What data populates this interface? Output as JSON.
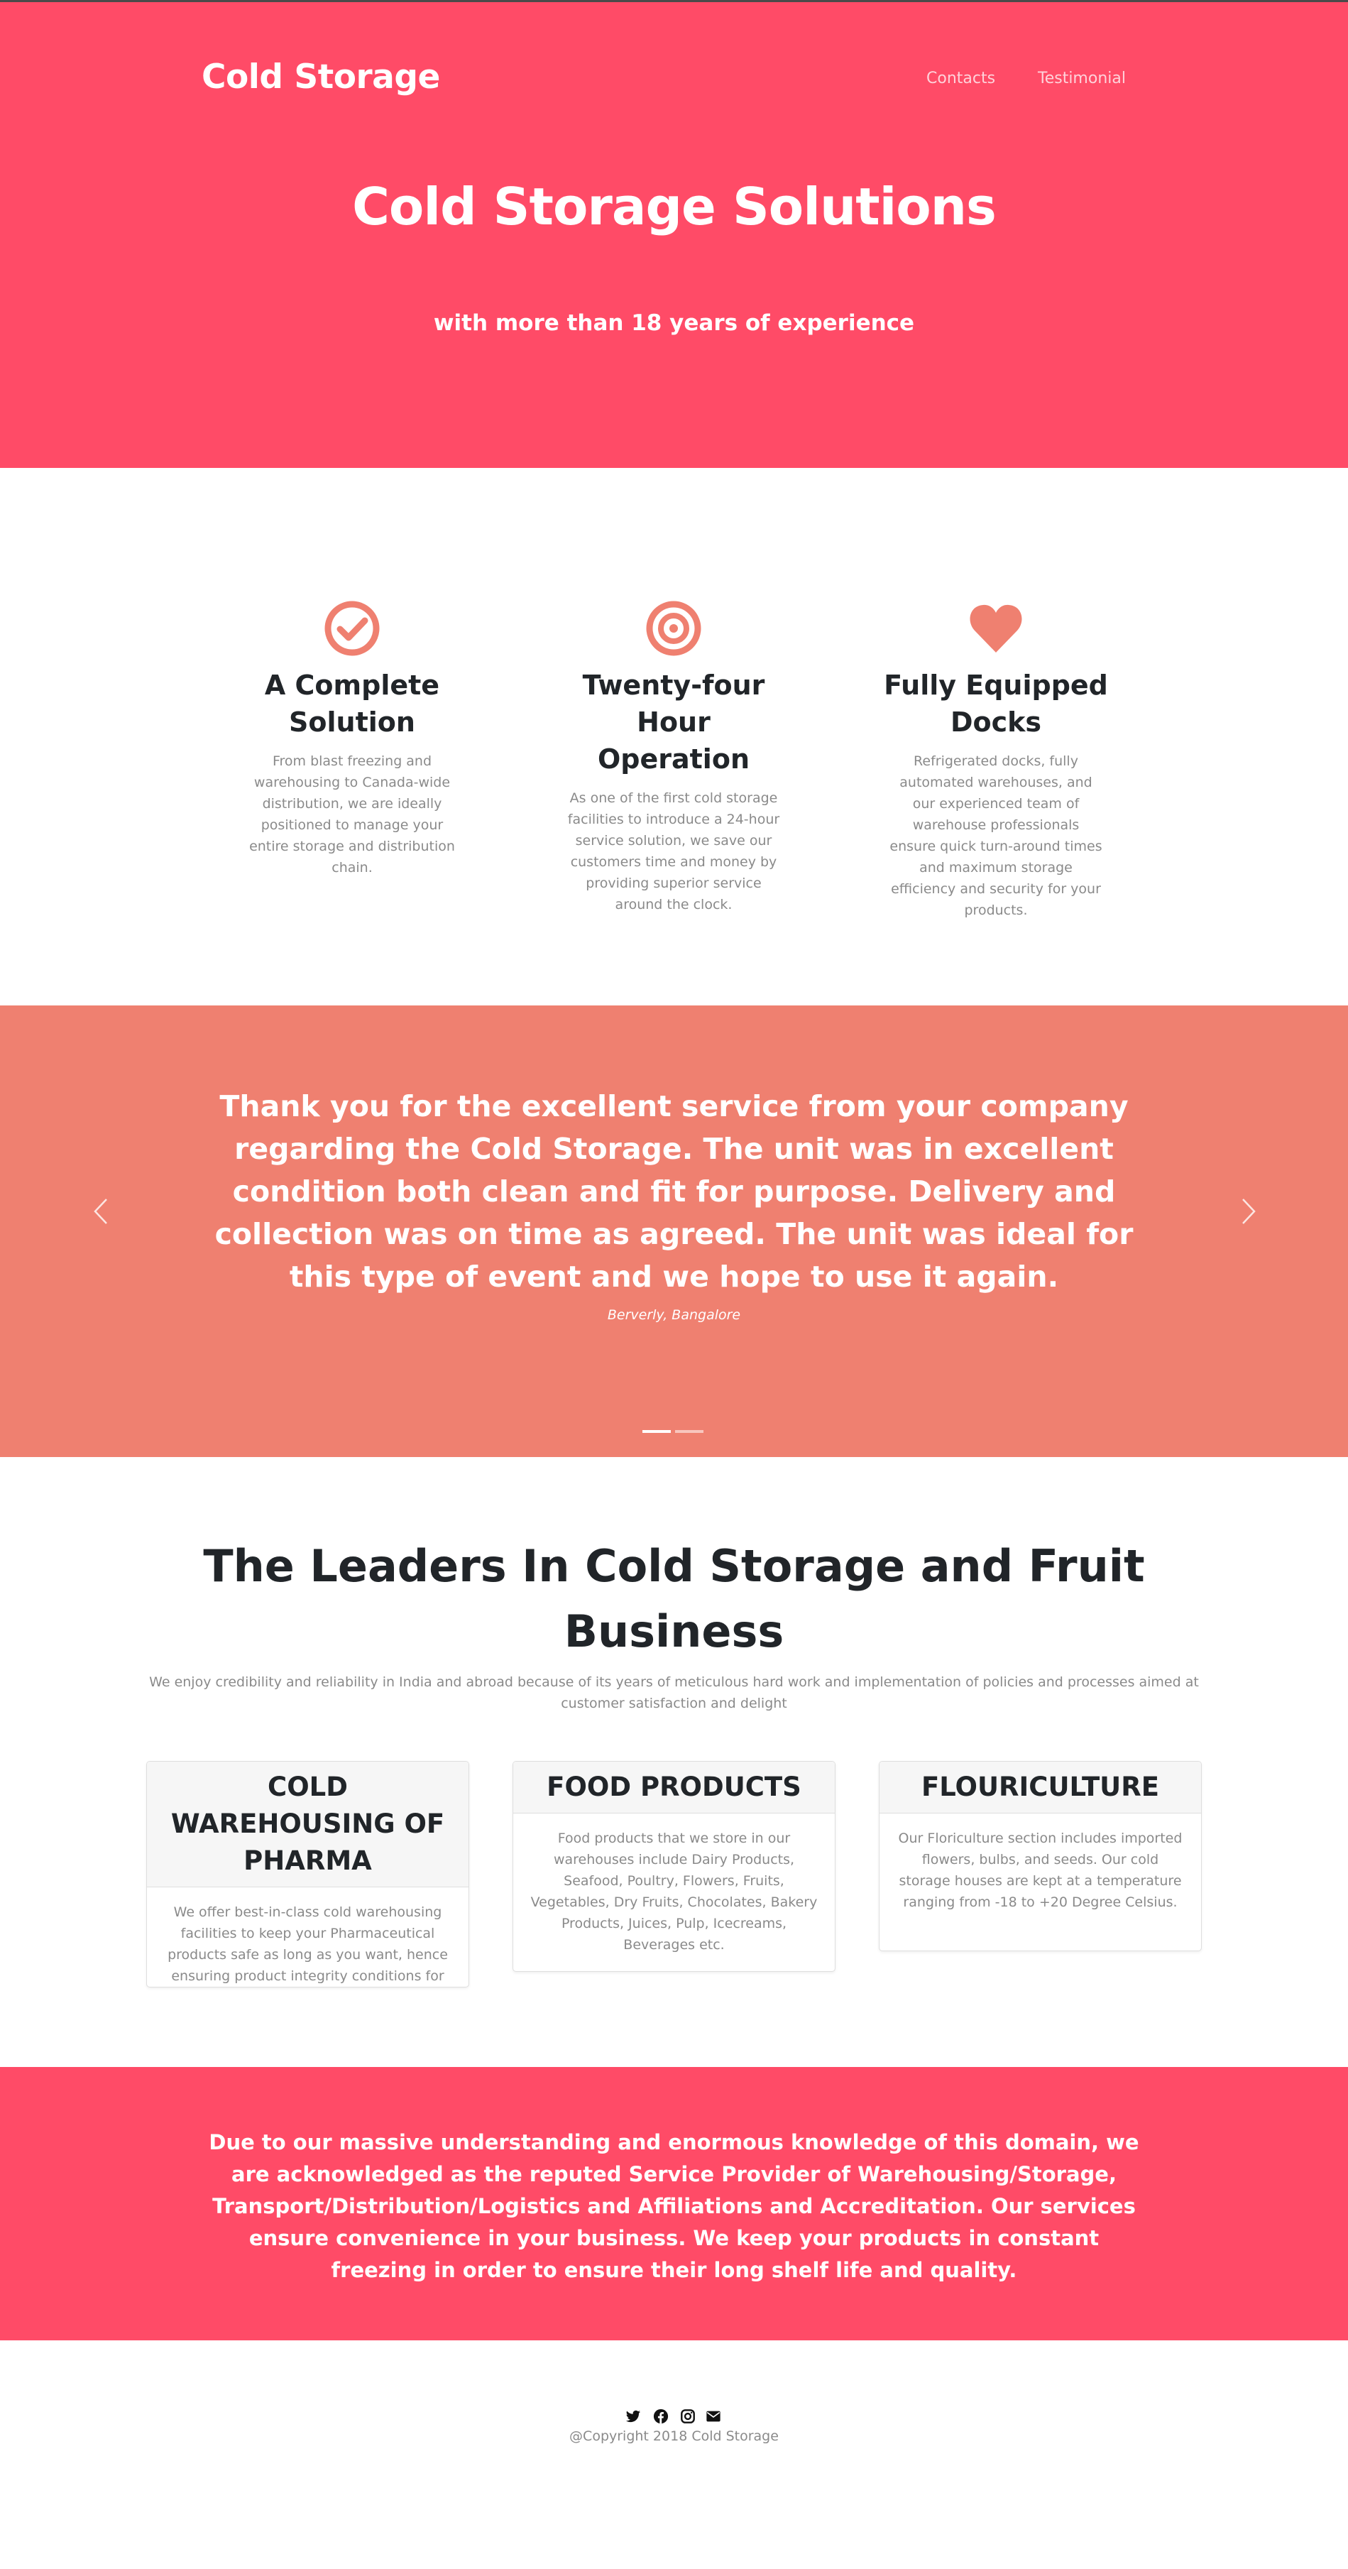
{
  "header": {
    "brand": "Cold Storage",
    "nav": [
      "Contacts",
      "Testimonial"
    ]
  },
  "hero": {
    "title": "Cold Storage Solutions",
    "subtitle": "with more than 18 years of experience"
  },
  "features": [
    {
      "icon": "check-circle-icon",
      "title": "A Complete Solution",
      "text": "From blast freezing and warehousing to Canada-wide distribution, we are ideally positioned to manage your entire storage and distribution chain."
    },
    {
      "icon": "bullseye-icon",
      "title": "Twenty-four Hour Operation",
      "text": "As one of the first cold storage facilities to introduce a 24-hour service solution, we save our customers time and money by providing superior service around the clock."
    },
    {
      "icon": "heart-icon",
      "title": "Fully Equipped Docks",
      "text": "Refrigerated docks, fully automated warehouses, and our experienced team of warehouse professionals ensure quick turn-around times and maximum storage efficiency and security for your products."
    }
  ],
  "testimonial": {
    "quote": "Thank you for the excellent service from your company regarding the Cold Storage. The unit was in excellent condition both clean and fit for purpose. Delivery and collection was on time as agreed. The unit was ideal for this type of event and we hope to use it again.",
    "author": "Berverly, Bangalore",
    "slides": 2,
    "active_slide": 1
  },
  "leaders": {
    "title": "The Leaders In Cold Storage and Fruit Business",
    "subtitle": "We enjoy credibility and reliability in India and abroad because of its years of meticulous hard work and implementation of policies and processes aimed at customer satisfaction and delight",
    "cards": [
      {
        "title": "COLD WAREHOUSING OF PHARMA",
        "text": "We offer best-in-class cold warehousing facilities to keep your Pharmaceutical products safe as long as you want, hence ensuring product integrity conditions for your drugs."
      },
      {
        "title": "FOOD PRODUCTS",
        "text": "Food products that we store in our warehouses include Dairy Products, Seafood, Poultry, Flowers, Fruits, Vegetables, Dry Fruits, Chocolates, Bakery Products, Juices, Pulp, Icecreams, Beverages etc."
      },
      {
        "title": "FLOURICULTURE",
        "text": "Our Floriculture section includes imported flowers, bulbs, and seeds. Our cold storage houses are kept at a temperature ranging from -18 to +20 Degree Celsius."
      }
    ]
  },
  "banner": {
    "text": "Due to our massive understanding and enormous knowledge of this domain, we are acknowledged as the reputed Service Provider of Warehousing/Storage, Transport/Distribution/Logistics and Affiliations and Accreditation. Our services ensure convenience in your business. We keep your products in constant freezing in order to ensure their long shelf life and quality."
  },
  "footer": {
    "social_icons": [
      "twitter-icon",
      "facebook-icon",
      "instagram-icon",
      "envelope-icon"
    ],
    "copyright": "@Copyright 2018 Cold Storage"
  },
  "colors": {
    "primary": "#ff4b67",
    "salmon": "#ef8070",
    "text_dark": "#212529",
    "text_muted": "#8a8a8a"
  }
}
